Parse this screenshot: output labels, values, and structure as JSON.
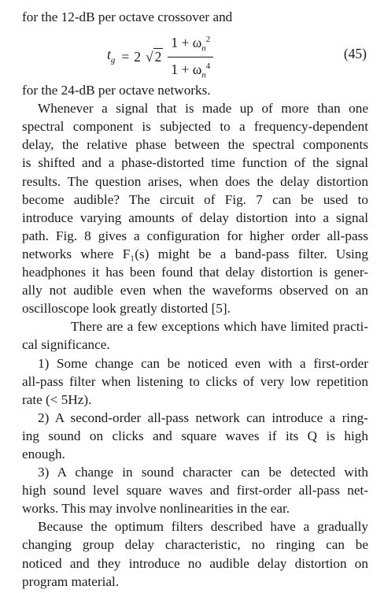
{
  "paragraph_intro": "for the 12-dB per octave crossover and",
  "equation": {
    "lhs_symbol": "t",
    "lhs_subscript": "g",
    "equals": "=",
    "coefficient": "2",
    "radical": "√",
    "radicand": "2",
    "numerator": "1 + ω",
    "numerator_subscript": "n",
    "numerator_superscript": "2",
    "denominator": "1 + ω",
    "denominator_subscript": "n",
    "denominator_superscript": "4",
    "number": "(45)"
  },
  "paragraph_after_eq": "for the 24-dB per octave networks.",
  "paragraph_delay": [
    "Whenever a signal that is made up of more than one",
    "spectral component is subjected to a frequency-dependent",
    "delay, the relative phase between the spectral components",
    "is shifted and a phase-distorted time function of the signal",
    "results. The question arises, when does the delay distortion",
    "become audible? The circuit of Fig. 7 can be used to",
    "introduce varying amounts of delay distortion into a signal",
    "path. Fig. 8 gives a configuration for higher order all-pass",
    "networks where F₁(s) might be a band-pass filter. Using",
    "headphones it has been found that delay distortion is gener-",
    "ally not audible even when the waveforms observed on an",
    "oscilloscope look greatly distorted [5]."
  ],
  "paragraph_exceptions": [
    "There are a few exceptions which have limited practi-",
    "cal significance."
  ],
  "item_1": [
    "1) Some change can be noticed even with a first-order",
    "all-pass filter when listening to clicks of very low repetition",
    "rate (< 5Hz)."
  ],
  "item_2": [
    "2) A second-order all-pass network can introduce a ring-",
    "ing sound on clicks and square waves if its Q is high",
    "enough."
  ],
  "item_3": [
    "3) A change in sound character can be detected with",
    "high sound level square waves and first-order all-pass net-",
    "works. This may involve nonlinearities in the ear."
  ],
  "paragraph_conclusion": [
    "Because the optimum filters described have a gradually",
    "changing group delay characteristic, no ringing can be",
    "noticed and they introduce no audible delay distortion on",
    "program material."
  ]
}
